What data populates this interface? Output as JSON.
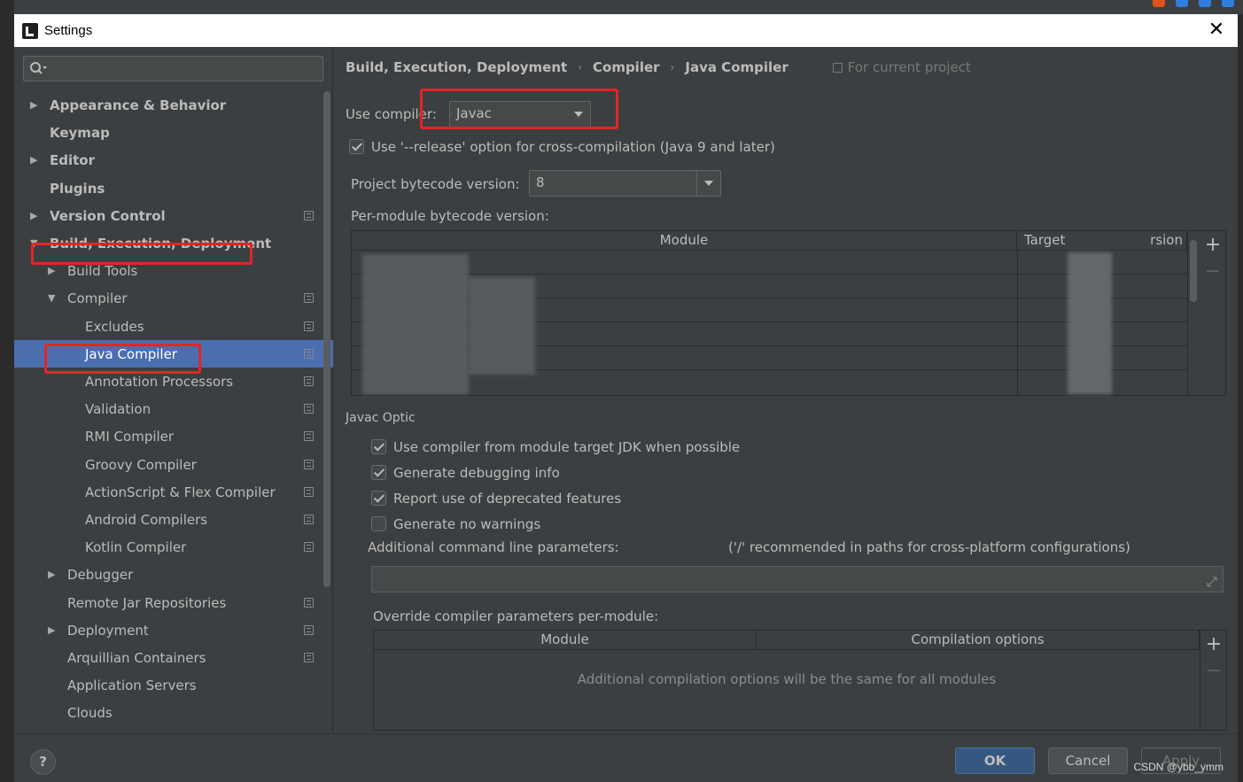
{
  "window": {
    "title": "Settings",
    "close_glyph": "✕"
  },
  "search": {
    "value": "",
    "icon_glyph": "🔍︎"
  },
  "tree": {
    "items": [
      {
        "label": "Appearance & Behavior",
        "level": 0,
        "bold": true,
        "arrow": "▶",
        "project": false
      },
      {
        "label": "Keymap",
        "level": 0,
        "bold": true,
        "arrow": "",
        "project": false
      },
      {
        "label": "Editor",
        "level": 0,
        "bold": true,
        "arrow": "▶",
        "project": false
      },
      {
        "label": "Plugins",
        "level": 0,
        "bold": true,
        "arrow": "",
        "project": false
      },
      {
        "label": "Version Control",
        "level": 0,
        "bold": true,
        "arrow": "▶",
        "project": true
      },
      {
        "label": "Build, Execution, Deployment",
        "level": 0,
        "bold": true,
        "arrow": "▼",
        "project": false
      },
      {
        "label": "Build Tools",
        "level": 1,
        "bold": false,
        "arrow": "▶",
        "project": false
      },
      {
        "label": "Compiler",
        "level": 1,
        "bold": false,
        "arrow": "▼",
        "project": true
      },
      {
        "label": "Excludes",
        "level": 2,
        "bold": false,
        "arrow": "",
        "project": true
      },
      {
        "label": "Java Compiler",
        "level": 2,
        "bold": false,
        "arrow": "",
        "project": true,
        "selected": true
      },
      {
        "label": "Annotation Processors",
        "level": 2,
        "bold": false,
        "arrow": "",
        "project": true
      },
      {
        "label": "Validation",
        "level": 2,
        "bold": false,
        "arrow": "",
        "project": true
      },
      {
        "label": "RMI Compiler",
        "level": 2,
        "bold": false,
        "arrow": "",
        "project": true
      },
      {
        "label": "Groovy Compiler",
        "level": 2,
        "bold": false,
        "arrow": "",
        "project": true
      },
      {
        "label": "ActionScript & Flex Compiler",
        "level": 2,
        "bold": false,
        "arrow": "",
        "project": true
      },
      {
        "label": "Android Compilers",
        "level": 2,
        "bold": false,
        "arrow": "",
        "project": true
      },
      {
        "label": "Kotlin Compiler",
        "level": 2,
        "bold": false,
        "arrow": "",
        "project": true
      },
      {
        "label": "Debugger",
        "level": 1,
        "bold": false,
        "arrow": "▶",
        "project": false
      },
      {
        "label": "Remote Jar Repositories",
        "level": 1,
        "bold": false,
        "arrow": "",
        "project": true
      },
      {
        "label": "Deployment",
        "level": 1,
        "bold": false,
        "arrow": "▶",
        "project": true
      },
      {
        "label": "Arquillian Containers",
        "level": 1,
        "bold": false,
        "arrow": "",
        "project": true
      },
      {
        "label": "Application Servers",
        "level": 1,
        "bold": false,
        "arrow": "",
        "project": false
      },
      {
        "label": "Clouds",
        "level": 1,
        "bold": false,
        "arrow": "",
        "project": false
      }
    ]
  },
  "breadcrumb": {
    "items": [
      "Build, Execution, Deployment",
      "Compiler",
      "Java Compiler"
    ],
    "separator": "›",
    "for_current_project": "For current project"
  },
  "compiler": {
    "use_compiler_label": "Use compiler:",
    "use_compiler_value": "Javac",
    "release_option_label": "Use '--release' option for cross-compilation (Java 9 and later)",
    "release_option_checked": true,
    "bytecode_label": "Project bytecode version:",
    "bytecode_value": "8",
    "per_module_label": "Per-module bytecode version:",
    "module_table": {
      "columns": [
        "Module",
        "Target bytecode version"
      ],
      "visible_header_2": "Target",
      "visible_header_2_tail": "rsion",
      "row_count": 6
    }
  },
  "javac_options": {
    "section_label": "Javac Optic",
    "checkboxes": [
      {
        "label": "Use compiler from module target JDK when possible",
        "checked": true
      },
      {
        "label": "Generate debugging info",
        "checked": true
      },
      {
        "label": "Report use of deprecated features",
        "checked": true
      },
      {
        "label": "Generate no warnings",
        "checked": false
      }
    ],
    "additional_params_label": "Additional command line parameters:",
    "additional_params_hint": "('/' recommended in paths for cross-platform configurations)",
    "additional_params_value": "",
    "override_label": "Override compiler parameters per-module:",
    "override_table": {
      "columns": [
        "Module",
        "Compilation options"
      ],
      "empty_text": "Additional compilation options will be the same for all modules"
    },
    "add_glyph": "+",
    "remove_glyph": "−"
  },
  "buttons": {
    "help": "?",
    "ok": "OK",
    "cancel": "Cancel",
    "apply": "Apply"
  },
  "watermark": "CSDN @ybb_ymm",
  "colors": {
    "selection": "#4b6eaf",
    "highlight_box": "#e52424",
    "ok_button": "#365880"
  }
}
